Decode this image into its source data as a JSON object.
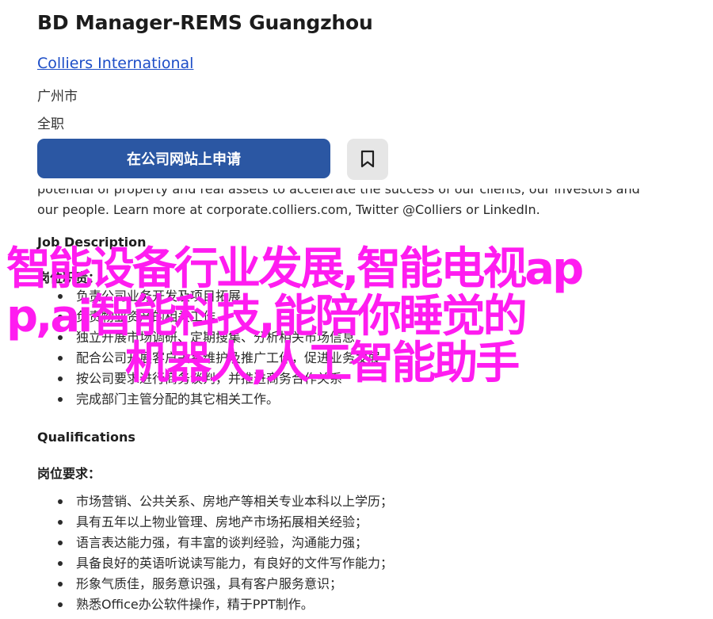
{
  "job": {
    "title": "BD Manager-REMS Guangzhou",
    "company": "Colliers International",
    "location": "广州市",
    "job_type": "全职"
  },
  "actions": {
    "apply_label": "在公司网站上申请",
    "save_icon": "bookmark-icon"
  },
  "description": {
    "intro_line_1": "potential of property and real assets to accelerate the success of our clients, our investors and",
    "intro_line_2": "our people. Learn more at corporate.colliers.com, Twitter @Colliers or LinkedIn.",
    "heading": "Job Description",
    "duties_heading": "岗位职责：",
    "duties": [
      "负责公司业务开发及项目拓展",
      "负责物业资产的相关工作",
      "独立开展市场调研、定期搜集、分析相关市场信息",
      "配合公司开展客户关系维护及推广工作，促进业务发展",
      "按公司要求进行商务谈判，并推进商务合作关系",
      "完成部门主管分配的其它相关工作。"
    ]
  },
  "qualifications": {
    "heading": "Qualifications",
    "requirements_heading": "岗位要求：",
    "requirements": [
      "市场营销、公共关系、房地产等相关专业本科以上学历；",
      "具有五年以上物业管理、房地产市场拓展相关经验；",
      "语言表达能力强，有丰富的谈判经验，沟通能力强；",
      "具备良好的英语听说读写能力，有良好的文件写作能力；",
      "形象气质佳，服务意识强，具有客户服务意识；",
      "熟悉Office办公软件操作，精于PPT制作。"
    ]
  },
  "overlay": {
    "line_1": "智能设备行业发展,智能电视ap",
    "line_2": "p,ai智能科技,能陪你睡觉的",
    "line_3": "机器人,人工智能助手",
    "color": "#ff1cf0"
  }
}
